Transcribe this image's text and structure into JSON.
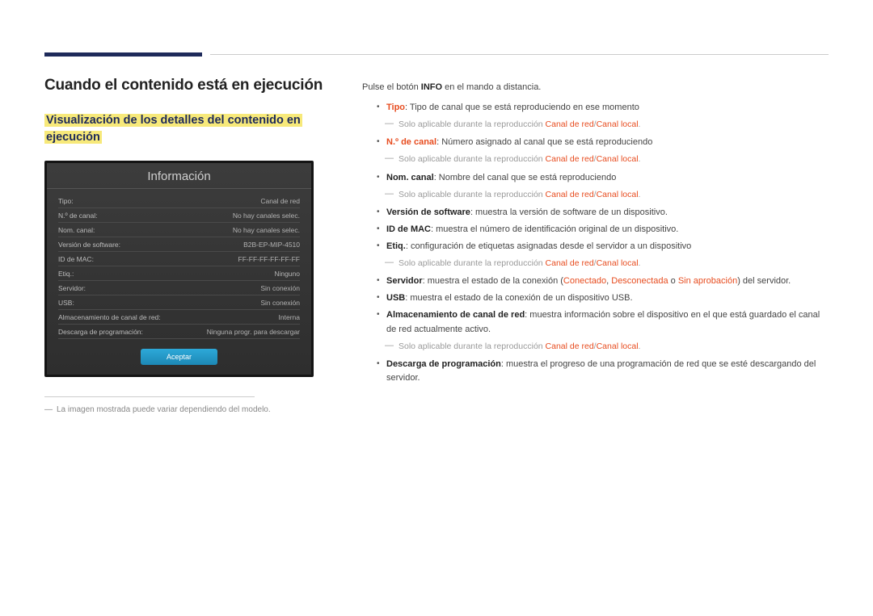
{
  "header": {},
  "left": {
    "h1": "Cuando el contenido está en ejecución",
    "h2_line1": "Visualización de los detalles del contenido en",
    "h2_line2": "ejecución",
    "panel": {
      "title": "Información",
      "rows": [
        {
          "label": "Tipo:",
          "value": "Canal de red"
        },
        {
          "label": "N.º de canal:",
          "value": "No hay canales selec."
        },
        {
          "label": "Nom. canal:",
          "value": "No hay canales selec."
        },
        {
          "label": "Versión de software:",
          "value": "B2B-EP-MIP-4510"
        },
        {
          "label": "ID de MAC:",
          "value": "FF-FF-FF-FF-FF-FF"
        },
        {
          "label": "Etiq.:",
          "value": "Ninguno"
        },
        {
          "label": "Servidor:",
          "value": "Sin conexión"
        },
        {
          "label": "USB:",
          "value": "Sin conexión"
        },
        {
          "label": "Almacenamiento de canal de red:",
          "value": "Interna"
        },
        {
          "label": "Descarga de programación:",
          "value": "Ninguna progr. para descargar"
        }
      ],
      "button": "Aceptar"
    },
    "footnote": "La imagen mostrada puede variar dependiendo del modelo."
  },
  "right": {
    "intro_pre": "Pulse el botón ",
    "intro_b": "INFO",
    "intro_post": " en el mando a distancia.",
    "sub_applicable": "Solo aplicable durante la reproducción ",
    "sub_link1": "Canal de red",
    "sub_slash": "/",
    "sub_link2": "Canal local",
    "sub_dot": ".",
    "items": {
      "tipo": {
        "label": "Tipo",
        "desc": ": Tipo de canal que se está reproduciendo en ese momento"
      },
      "ncanal": {
        "label": "N.º de canal",
        "desc": ": Número asignado al canal que se está reproduciendo"
      },
      "nomcanal": {
        "label": "Nom. canal",
        "desc": ": Nombre del canal que se está reproduciendo"
      },
      "ver": {
        "label": "Versión de software",
        "desc": ": muestra la versión de software de un dispositivo."
      },
      "mac": {
        "label": "ID de MAC",
        "desc": ": muestra el número de identificación original de un dispositivo."
      },
      "etiq": {
        "label": "Etiq.",
        "desc": ": configuración de etiquetas asignadas desde el servidor a un dispositivo"
      },
      "serv": {
        "label": "Servidor",
        "desc_pre": ": muestra el estado de la conexión (",
        "c1": "Conectado",
        "sep1": ", ",
        "c2": "Desconectada",
        "sep2": " o ",
        "c3": "Sin aprobación",
        "desc_post": ") del servidor."
      },
      "usb": {
        "label": "USB",
        "desc": ": muestra el estado de la conexión de un dispositivo USB."
      },
      "alm": {
        "label": "Almacenamiento de canal de red",
        "desc": ": muestra información sobre el dispositivo en el que está guardado el canal de red actualmente activo."
      },
      "desc": {
        "label": "Descarga de programación",
        "desc": ": muestra el progreso de una programación de red que se esté descargando del servidor."
      }
    }
  }
}
